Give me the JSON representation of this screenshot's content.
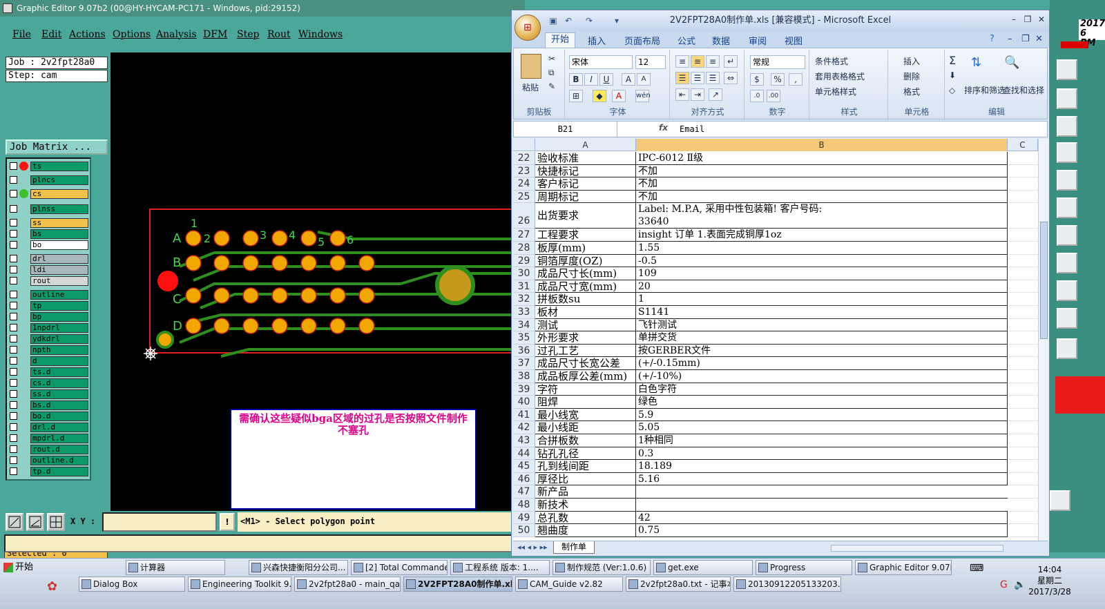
{
  "ge": {
    "title": "Graphic Editor 9.07b2 (00@HY-HYCAM-PC171 - Windows, pid:29152)",
    "menu": [
      "File",
      "Edit",
      "Actions",
      "Options",
      "Analysis",
      "DFM",
      "Step",
      "Rout",
      "Windows"
    ],
    "job": "Job : 2v2fpt28a0",
    "step": "Step: cam",
    "job_matrix": "Job Matrix ...",
    "layers": [
      {
        "name": "ts",
        "color": "#0c9a6c"
      },
      {
        "name": "plncs",
        "color": "#0c9a6c"
      },
      {
        "name": "cs",
        "color": "#f2c14a"
      },
      {
        "name": "plnss",
        "color": "#0c9a6c"
      },
      {
        "name": "ss",
        "color": "#f2c14a"
      },
      {
        "name": "bs",
        "color": "#0c9a6c"
      },
      {
        "name": "bo",
        "color": "#ffffff"
      },
      {
        "name": "drl",
        "color": "#a9b8bb"
      },
      {
        "name": "ldi",
        "color": "#a9b8bb"
      },
      {
        "name": "rout",
        "color": "#d7d7d7"
      },
      {
        "name": "outline",
        "color": "#0c9a6c"
      },
      {
        "name": "tp",
        "color": "#0c9a6c"
      },
      {
        "name": "bp",
        "color": "#0c9a6c"
      },
      {
        "name": "1npdrl",
        "color": "#0c9a6c"
      },
      {
        "name": "ydkdrl",
        "color": "#0c9a6c"
      },
      {
        "name": "npth",
        "color": "#0c9a6c"
      },
      {
        "name": "d",
        "color": "#0c9a6c"
      },
      {
        "name": "ts.d",
        "color": "#0c9a6c"
      },
      {
        "name": "cs.d",
        "color": "#0c9a6c"
      },
      {
        "name": "ss.d",
        "color": "#0c9a6c"
      },
      {
        "name": "bs.d",
        "color": "#0c9a6c"
      },
      {
        "name": "bo.d",
        "color": "#0c9a6c"
      },
      {
        "name": "drl.d",
        "color": "#0c9a6c"
      },
      {
        "name": "mpdrl.d",
        "color": "#0c9a6c"
      },
      {
        "name": "rout.d",
        "color": "#0c9a6c"
      },
      {
        "name": "outline.d",
        "color": "#0c9a6c"
      },
      {
        "name": "tp.d",
        "color": "#0c9a6c"
      }
    ],
    "selected": "Selected : 0",
    "xy_label": "X Y :",
    "xy_value": "",
    "prompt": "<M1> - Select polygon point",
    "note": "需确认这些疑似bga区域的过孔是否按照文件制作不塞孔",
    "pcb_labels": [
      "A",
      "B",
      "C",
      "D",
      "1",
      "2",
      "3",
      "4",
      "5",
      "6"
    ]
  },
  "excel": {
    "title": "2V2FPT28A0制作单.xls [兼容模式] - Microsoft Excel",
    "tabs": [
      "开始",
      "插入",
      "页面布局",
      "公式",
      "数据",
      "审阅",
      "视图"
    ],
    "font_name": "宋体",
    "font_size": "12",
    "number_format": "常规",
    "groups": [
      "剪贴板",
      "字体",
      "对齐方式",
      "数字",
      "样式",
      "单元格",
      "编辑"
    ],
    "paste": "粘贴",
    "styles": [
      "条件格式",
      "套用表格格式",
      "单元格样式"
    ],
    "cells_cmds": [
      "插入",
      "删除",
      "格式"
    ],
    "edit_cmds": [
      "排序和筛选",
      "查找和选择"
    ],
    "name_box": "B21",
    "formula": "Email",
    "columns": [
      "A",
      "B",
      "C"
    ],
    "rows": [
      {
        "n": "22",
        "a": "验收标准",
        "b": "IPC-6012 Ⅱ级"
      },
      {
        "n": "23",
        "a": "快捷标记",
        "b": "不加"
      },
      {
        "n": "24",
        "a": "客户标记",
        "b": "不加"
      },
      {
        "n": "25",
        "a": "周期标记",
        "b": "不加"
      },
      {
        "n": "26",
        "a": "出货要求",
        "b": "Label: M.P.A, 采用中性包装箱! 客户号码:",
        "b2": "33640"
      },
      {
        "n": "27",
        "a": "工程要求",
        "b": "insight 订单 1.表面完成铜厚1oz"
      },
      {
        "n": "28",
        "a": "板厚(mm)",
        "b": "1.55"
      },
      {
        "n": "29",
        "a": "铜箔厚度(OZ)",
        "b": "-0.5"
      },
      {
        "n": "30",
        "a": "成品尺寸长(mm)",
        "b": "109"
      },
      {
        "n": "31",
        "a": "成品尺寸宽(mm)",
        "b": "20"
      },
      {
        "n": "32",
        "a": "拼板数su",
        "b": "1"
      },
      {
        "n": "33",
        "a": "板材",
        "b": "S1141"
      },
      {
        "n": "34",
        "a": "测试",
        "b": "飞针测试"
      },
      {
        "n": "35",
        "a": "外形要求",
        "b": "单拼交货"
      },
      {
        "n": "36",
        "a": "过孔工艺",
        "b": "按GERBER文件"
      },
      {
        "n": "37",
        "a": "成品尺寸长宽公差",
        "b": "(+/-0.15mm)"
      },
      {
        "n": "38",
        "a": "成品板厚公差(mm)",
        "b": "(+/-10%)"
      },
      {
        "n": "39",
        "a": "字符",
        "b": "白色字符"
      },
      {
        "n": "40",
        "a": "阻焊",
        "b": "绿色"
      },
      {
        "n": "41",
        "a": "最小线宽",
        "b": "5.9"
      },
      {
        "n": "42",
        "a": "最小线距",
        "b": "5.05"
      },
      {
        "n": "43",
        "a": "合拼板数",
        "b": "1种相同"
      },
      {
        "n": "44",
        "a": "钻孔孔径",
        "b": "0.3"
      },
      {
        "n": "45",
        "a": "孔到线间距",
        "b": "18.189"
      },
      {
        "n": "46",
        "a": "厚径比",
        "b": "5.16"
      },
      {
        "n": "47",
        "a": "新产品",
        "b": ""
      },
      {
        "n": "48",
        "a": "新技术",
        "b": ""
      },
      {
        "n": "49",
        "a": "总孔数",
        "b": "42"
      },
      {
        "n": "50",
        "a": "翘曲度",
        "b": "0.75"
      }
    ],
    "sheet_tab": "制作单"
  },
  "taskbar": {
    "start": "开始",
    "row1": [
      "计算器",
      "兴森快捷衡阳分公司...",
      "[2] Total Commander ...",
      "工程系统  版本: 1....",
      "制作规范 (Ver:1.0.6)",
      "get.exe",
      "Progress",
      "Graphic Editor 9.07b2 ..."
    ],
    "row2": [
      "Dialog Box",
      "Engineering Toolkit 9.07...",
      "2v2fpt28a0 - main_qa",
      "2V2FPT28A0制作单.xl...",
      "CAM_Guide v2.82",
      "2v2fpt28a0.txt - 记事本",
      "20130912205133203.rtf..."
    ],
    "time": "14:04",
    "day": "星期二",
    "date": "2017/3/28"
  },
  "right_strip": {
    "time_text": "2017",
    "pm_text": "6 PM"
  }
}
